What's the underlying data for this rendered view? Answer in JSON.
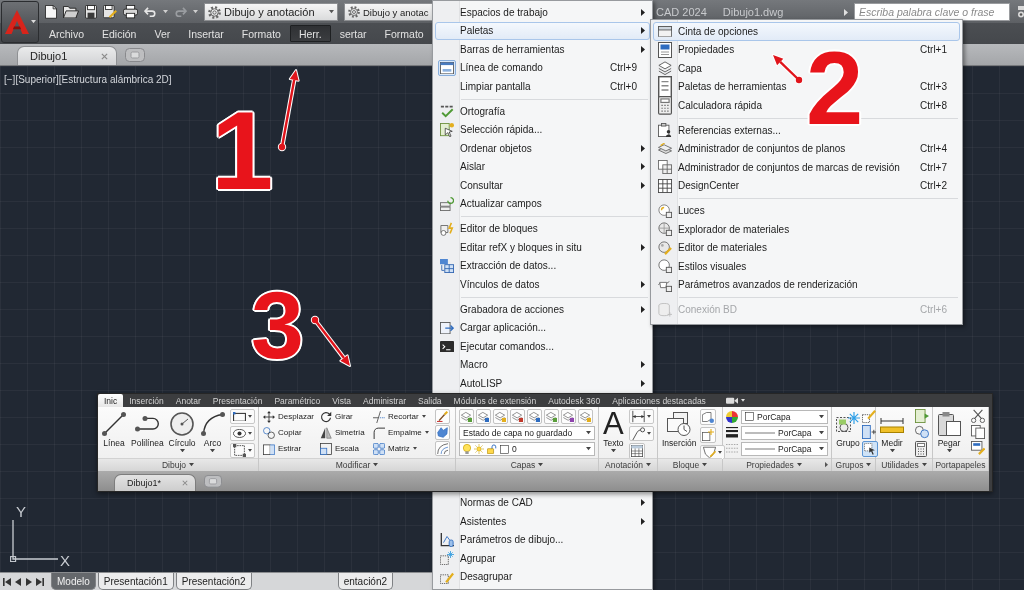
{
  "title_bar": {
    "workspace": "Dibujo y anotación",
    "workspace_overlap": "Dibujo y anotac",
    "app_name": "CAD 2024",
    "file_name": "Dibujo1.dwg",
    "search": {
      "placeholder": "Escriba palabra clave o frase"
    }
  },
  "menu_bar": {
    "items": [
      {
        "label": "Archivo",
        "selected": false
      },
      {
        "label": "Edición",
        "selected": false
      },
      {
        "label": "Ver",
        "selected": false
      },
      {
        "label": "Insertar",
        "selected": false
      },
      {
        "label": "Formato",
        "selected": false
      },
      {
        "label": "Herr.",
        "selected": true
      }
    ],
    "overlap_items": [
      "sertar",
      "Formato"
    ]
  },
  "file_tabs": [
    {
      "label": "Dibujo1",
      "selected": true
    }
  ],
  "viewport_label": "[−][Superior][Estructura alámbrica 2D]",
  "ucs": {
    "y_label": "Y",
    "x_label": "X"
  },
  "layout_tabs": {
    "items": [
      {
        "label": "Modelo",
        "selected": true
      },
      {
        "label": "Presentación1",
        "selected": false
      },
      {
        "label": "Presentación2",
        "selected": false
      }
    ],
    "overlap_fragment": "entación2"
  },
  "tools_menu": {
    "groups": [
      {
        "items": [
          {
            "label": "Espacios de trabajo",
            "submenu": true,
            "selected": false,
            "checked": false
          },
          {
            "label": "Paletas",
            "submenu": true,
            "selected": true,
            "checked": false
          },
          {
            "label": "Barras de herramientas",
            "submenu": true,
            "selected": false,
            "checked": false
          },
          {
            "label": "Línea de comando",
            "shortcut": "Ctrl+9",
            "submenu": false,
            "selected": false,
            "checked": true
          },
          {
            "label": "Limpiar pantalla",
            "shortcut": "Ctrl+0",
            "submenu": false,
            "selected": false,
            "checked": false
          }
        ]
      },
      {
        "items": [
          {
            "label": "Ortografía",
            "submenu": false,
            "selected": false,
            "checked": false
          },
          {
            "label": "Selección rápida...",
            "submenu": false,
            "selected": false,
            "checked": false
          },
          {
            "label": "Ordenar objetos",
            "submenu": true,
            "selected": false,
            "checked": false
          },
          {
            "label": "Aislar",
            "submenu": true,
            "selected": false,
            "checked": false
          },
          {
            "label": "Consultar",
            "submenu": true,
            "selected": false,
            "checked": false
          },
          {
            "label": "Actualizar campos",
            "submenu": false,
            "selected": false,
            "checked": false
          }
        ]
      },
      {
        "items": [
          {
            "label": "Editor de bloques",
            "submenu": false,
            "selected": false,
            "checked": false
          },
          {
            "label": "Editar refX y bloques in situ",
            "submenu": true,
            "selected": false,
            "checked": false
          },
          {
            "label": "Extracción de datos...",
            "submenu": false,
            "selected": false,
            "checked": false
          },
          {
            "label": "Vínculos de datos",
            "submenu": true,
            "selected": false,
            "checked": false
          }
        ]
      },
      {
        "items": [
          {
            "label": "Grabadora de acciones",
            "submenu": true,
            "selected": false,
            "checked": false
          },
          {
            "label": "Cargar aplicación...",
            "submenu": false,
            "selected": false,
            "checked": false
          },
          {
            "label": "Ejecutar comandos...",
            "submenu": false,
            "selected": false,
            "checked": false
          },
          {
            "label": "Macro",
            "submenu": true,
            "selected": false,
            "checked": false
          },
          {
            "label": "AutoLISP",
            "submenu": true,
            "selected": false,
            "checked": false
          }
        ]
      }
    ],
    "lower_items": [
      {
        "label": "Normas de CAD",
        "submenu": true,
        "selected": false,
        "checked": false
      },
      {
        "label": "Asistentes",
        "submenu": true,
        "selected": false,
        "checked": false
      },
      {
        "label": "Parámetros de dibujo...",
        "submenu": false,
        "selected": false,
        "checked": false
      },
      {
        "label": "Agrupar",
        "submenu": false,
        "selected": false,
        "checked": false
      },
      {
        "label": "Desagrupar",
        "submenu": false,
        "selected": false,
        "checked": false
      }
    ]
  },
  "palettes_submenu": {
    "groups": [
      {
        "items": [
          {
            "label": "Cinta de opciones",
            "selected": true,
            "disabled": false
          },
          {
            "label": "Propiedades",
            "shortcut": "Ctrl+1",
            "selected": false,
            "disabled": false
          },
          {
            "label": "Capa",
            "selected": false,
            "disabled": false
          },
          {
            "label": "Paletas de herramientas",
            "shortcut": "Ctrl+3",
            "selected": false,
            "disabled": false
          },
          {
            "label": "Calculadora rápida",
            "shortcut": "Ctrl+8",
            "selected": false,
            "disabled": false
          }
        ]
      },
      {
        "items": [
          {
            "label": "Referencias externas...",
            "selected": false,
            "disabled": false
          },
          {
            "label": "Administrador de conjuntos de planos",
            "shortcut": "Ctrl+4",
            "selected": false,
            "disabled": false
          },
          {
            "label": "Administrador de conjuntos de marcas de revisión",
            "shortcut": "Ctrl+7",
            "selected": false,
            "disabled": false
          },
          {
            "label": "DesignCenter",
            "shortcut": "Ctrl+2",
            "selected": false,
            "disabled": false
          }
        ]
      },
      {
        "items": [
          {
            "label": "Luces",
            "selected": false,
            "disabled": false
          },
          {
            "label": "Explorador de materiales",
            "selected": false,
            "disabled": false
          },
          {
            "label": "Editor de materiales",
            "selected": false,
            "disabled": false
          },
          {
            "label": "Estilos visuales",
            "selected": false,
            "disabled": false
          },
          {
            "label": "Parámetros avanzados de renderización",
            "selected": false,
            "disabled": false
          }
        ]
      },
      {
        "items": [
          {
            "label": "Conexión BD",
            "shortcut": "Ctrl+6",
            "selected": false,
            "disabled": true
          }
        ]
      }
    ]
  },
  "ribbon": {
    "tabs": [
      {
        "label": "Inic",
        "selected": true
      },
      {
        "label": "Inserción",
        "selected": false
      },
      {
        "label": "Anotar",
        "selected": false
      },
      {
        "label": "Presentación",
        "selected": false
      },
      {
        "label": "Paramétrico",
        "selected": false
      },
      {
        "label": "Vista",
        "selected": false
      },
      {
        "label": "Administrar",
        "selected": false
      },
      {
        "label": "Salida",
        "selected": false
      },
      {
        "label": "Módulos de extensión",
        "selected": false
      },
      {
        "label": "Autodesk 360",
        "selected": false
      },
      {
        "label": "Aplicaciones destacadas",
        "selected": false
      }
    ],
    "panels": [
      {
        "kind": "draw",
        "title": "Dibujo",
        "expandable": true,
        "tools": [
          {
            "label": "Línea",
            "dropdown": false
          },
          {
            "label": "Polilínea",
            "dropdown": false
          },
          {
            "label": "Círculo",
            "dropdown": true
          },
          {
            "label": "Arco",
            "dropdown": true
          }
        ]
      },
      {
        "kind": "modify",
        "title": "Modificar",
        "expandable": true,
        "tools": [
          {
            "label": "Desplazar",
            "dropdown": false
          },
          {
            "label": "Girar",
            "dropdown": false
          },
          {
            "label": "Recortar",
            "dropdown": true
          },
          {
            "label": "Copiar",
            "dropdown": false
          },
          {
            "label": "Simetría",
            "dropdown": false
          },
          {
            "label": "Empalme",
            "dropdown": true
          },
          {
            "label": "Estirar",
            "dropdown": false
          },
          {
            "label": "Escala",
            "dropdown": false
          },
          {
            "label": "Matriz",
            "dropdown": true
          }
        ]
      },
      {
        "kind": "layers",
        "title": "Capas",
        "expandable": true,
        "layer_state": "Estado de capa no guardado",
        "current_layer": "0"
      },
      {
        "kind": "annotation",
        "title": "Anotación",
        "expandable": true,
        "tools": [
          {
            "label": "Texto",
            "glyph": "A",
            "dropdown": true
          }
        ]
      },
      {
        "kind": "block",
        "title": "Bloque",
        "expandable": true,
        "tools": [
          {
            "label": "Inserción",
            "dropdown": false
          }
        ]
      },
      {
        "kind": "properties",
        "title": "Propiedades",
        "expandable": true,
        "fields": [
          {
            "value": "PorCapa"
          },
          {
            "value": "PorCapa"
          },
          {
            "value": "PorCapa"
          }
        ]
      },
      {
        "kind": "groups",
        "title": "Grupos",
        "expandable": true,
        "tools": [
          {
            "label": "Grupo",
            "dropdown": false
          }
        ],
        "selection_toggle": {
          "on": true
        }
      },
      {
        "kind": "utilities",
        "title": "Utilidades",
        "expandable": true,
        "tools": [
          {
            "label": "Medir",
            "dropdown": true
          }
        ]
      },
      {
        "kind": "clipboard",
        "title": "Portapapeles",
        "expandable": false,
        "tools": [
          {
            "label": "Pegar",
            "dropdown": true
          }
        ]
      }
    ],
    "file_tabs": [
      {
        "label": "Dibujo1*",
        "selected": true
      }
    ]
  },
  "annotations": [
    {
      "label": "1"
    },
    {
      "label": "2"
    },
    {
      "label": "3"
    }
  ]
}
